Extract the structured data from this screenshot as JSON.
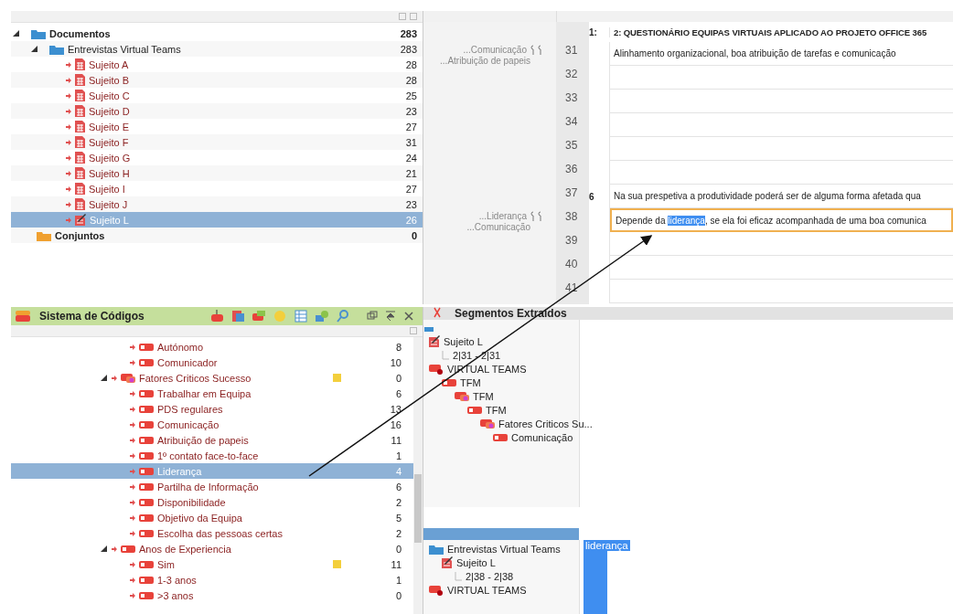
{
  "document_system": {
    "items": [
      {
        "label": "Documentos",
        "kind": "folder",
        "count": "283",
        "expanded": true,
        "selected": false,
        "children": [
          {
            "label": "Entrevistas Virtual Teams",
            "kind": "folder",
            "count": "283",
            "expanded": true,
            "selected": false,
            "children": [
              {
                "label": "Sujeito A",
                "kind": "document",
                "count": "28",
                "selected": false
              },
              {
                "label": "Sujeito B",
                "kind": "document",
                "count": "28",
                "selected": false
              },
              {
                "label": "Sujeito C",
                "kind": "document",
                "count": "25",
                "selected": false
              },
              {
                "label": "Sujeito D",
                "kind": "document",
                "count": "23",
                "selected": false
              },
              {
                "label": "Sujeito E",
                "kind": "document",
                "count": "27",
                "selected": false
              },
              {
                "label": "Sujeito F",
                "kind": "document",
                "count": "31",
                "selected": false
              },
              {
                "label": "Sujeito G",
                "kind": "document",
                "count": "24",
                "selected": false
              },
              {
                "label": "Sujeito H",
                "kind": "document",
                "count": "21",
                "selected": false
              },
              {
                "label": "Sujeito I",
                "kind": "document",
                "count": "27",
                "selected": false
              },
              {
                "label": "Sujeito J",
                "kind": "document",
                "count": "23",
                "selected": false
              },
              {
                "label": "Sujeito L",
                "kind": "open-document",
                "count": "26",
                "selected": true
              }
            ]
          }
        ]
      },
      {
        "label": "Conjuntos",
        "kind": "sets",
        "count": "0",
        "selected": false
      }
    ]
  },
  "document_browser": {
    "header": {
      "paragraph": "1:",
      "text": "2: QUESTIONÁRIO EQUIPAS VIRTUAIS APLICADO AO PROJETO OFFICE 365"
    },
    "lines": [
      {
        "number": "31",
        "selected": false,
        "codes": [
          "...Comunicação",
          "...Atribuição de papeis"
        ],
        "parts": [
          {
            "text": "Alinhamento organizacional, boa atribuição de tarefas e comunicação",
            "highlighted": false
          }
        ]
      },
      {
        "number": "32",
        "selected": false
      },
      {
        "number": "33",
        "selected": false
      },
      {
        "number": "34",
        "selected": false
      },
      {
        "number": "35",
        "selected": false
      },
      {
        "number": "36",
        "selected": false
      },
      {
        "number": "37",
        "selected": false,
        "paragraph": "6",
        "parts": [
          {
            "text": "Na sua prespetiva a produtividade poderá ser de alguma forma afetada qua",
            "highlighted": false
          }
        ]
      },
      {
        "number": "38",
        "selected": true,
        "codes": [
          "...Liderança",
          "...Comunicação"
        ],
        "parts": [
          {
            "text": "Depende da ",
            "highlighted": false
          },
          {
            "text": "liderança",
            "highlighted": true
          },
          {
            "text": ", se ela foi eficaz acompanhada de uma boa comunica",
            "highlighted": false
          }
        ]
      },
      {
        "number": "39",
        "selected": false
      },
      {
        "number": "40",
        "selected": false
      },
      {
        "number": "41",
        "selected": false
      }
    ]
  },
  "code_system": {
    "title": "Sistema de Códigos",
    "items": [
      {
        "children": [
          {
            "label": "Autónomo",
            "kind": "code",
            "count": "8",
            "memo": false,
            "selected": false
          },
          {
            "label": "Comunicador",
            "kind": "code",
            "count": "10",
            "memo": false,
            "selected": false
          }
        ]
      },
      {
        "label": "Fatores Criticos Sucesso",
        "kind": "codeset",
        "count": "0",
        "memo": true,
        "selected": false,
        "expanded": true,
        "children": [
          {
            "label": "Trabalhar em Equipa",
            "kind": "code",
            "count": "6",
            "memo": false,
            "selected": false
          },
          {
            "label": "PDS regulares",
            "kind": "code",
            "count": "13",
            "memo": false,
            "selected": false
          },
          {
            "label": "Comunicação",
            "kind": "code",
            "count": "16",
            "memo": false,
            "selected": false
          },
          {
            "label": "Atribuição de papeis",
            "kind": "code",
            "count": "11",
            "memo": false,
            "selected": false
          },
          {
            "label": "1º contato face-to-face",
            "kind": "code",
            "count": "1",
            "memo": false,
            "selected": false
          },
          {
            "label": "Liderança",
            "kind": "code",
            "count": "4",
            "memo": false,
            "selected": true
          },
          {
            "label": "Partilha de Informação",
            "kind": "code",
            "count": "6",
            "memo": false,
            "selected": false
          },
          {
            "label": "Disponibilidade",
            "kind": "code",
            "count": "2",
            "memo": false,
            "selected": false
          },
          {
            "label": "Objetivo da Equipa",
            "kind": "code",
            "count": "5",
            "memo": false,
            "selected": false
          },
          {
            "label": "Escolha das pessoas certas",
            "kind": "code",
            "count": "2",
            "memo": false,
            "selected": false
          }
        ]
      },
      {
        "label": "Anos de Experiencia",
        "kind": "code",
        "count": "0",
        "memo": false,
        "selected": false,
        "expanded": true,
        "children": [
          {
            "label": "Sim",
            "kind": "code",
            "count": "11",
            "memo": true,
            "selected": false
          },
          {
            "label": "1-3 anos",
            "kind": "code",
            "count": "1",
            "memo": false,
            "selected": false
          },
          {
            "label": ">3 anos",
            "kind": "code",
            "count": "0",
            "memo": false,
            "selected": false
          }
        ]
      }
    ]
  },
  "retrieved_segments": {
    "title": "Segmentos Extraídos",
    "segments": [
      {
        "selected": false,
        "tree": [
          {
            "label": "Sujeito L",
            "kind": "open-document",
            "children": [
              {
                "label": "2|31 - 2|31",
                "kind": "range"
              }
            ]
          },
          {
            "label": "VIRTUAL TEAMS",
            "kind": "project",
            "children": [
              {
                "label": "TFM",
                "kind": "code",
                "children": [
                  {
                    "label": "TFM",
                    "kind": "codeset",
                    "children": [
                      {
                        "label": "TFM",
                        "kind": "code",
                        "children": [
                          {
                            "label": "Fatores Criticos Su...",
                            "kind": "codeset",
                            "children": [
                              {
                                "label": "Comunicação",
                                "kind": "code"
                              }
                            ]
                          }
                        ]
                      }
                    ]
                  }
                ]
              }
            ]
          }
        ]
      },
      {
        "selected": true,
        "preview": "liderança",
        "tree": [
          {
            "label": "Entrevistas Virtual Teams",
            "kind": "folder",
            "children": [
              {
                "label": "Sujeito L",
                "kind": "open-document",
                "children": [
                  {
                    "label": "2|38 - 2|38",
                    "kind": "range"
                  }
                ]
              }
            ]
          },
          {
            "label": "VIRTUAL TEAMS",
            "kind": "project"
          }
        ]
      }
    ]
  }
}
